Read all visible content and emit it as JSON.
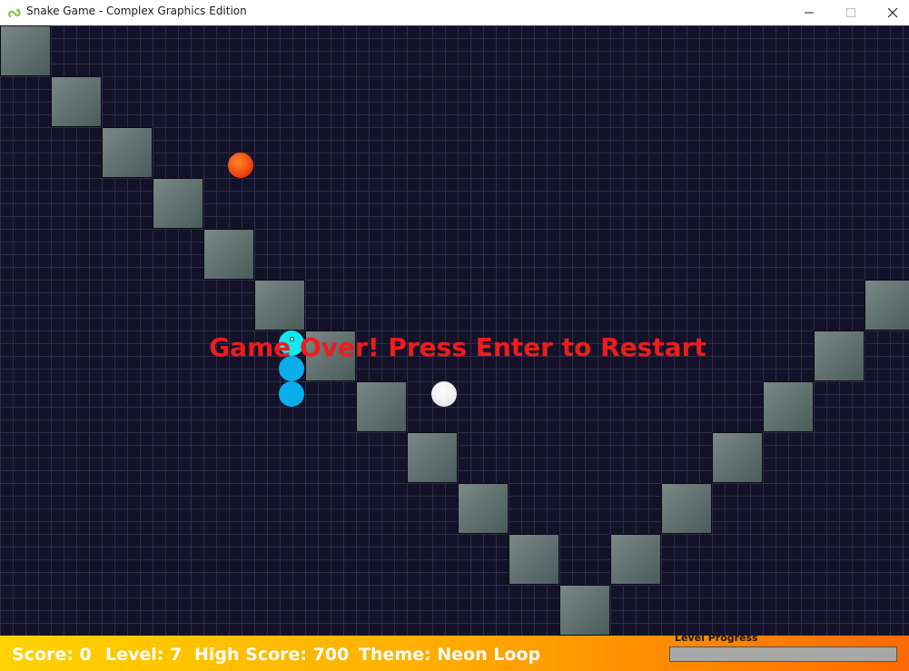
{
  "window": {
    "title": "Snake Game - Complex Graphics Edition",
    "icon": "snake-icon"
  },
  "board": {
    "grid_color": "#2c2d4a",
    "background_color": "#131228",
    "wall_color": "#5f6f6d"
  },
  "game": {
    "game_over_text": "Game Over! Press Enter to Restart",
    "game_over_color": "#ee1c1c",
    "snake_head_color": "#12e8ee",
    "snake_body_color": "#0aaeea",
    "food_colors": [
      "#f04a10",
      "#ececec"
    ]
  },
  "status": {
    "score_text": "Score: 0",
    "level_text": "Level: 7",
    "high_score_text": "High Score: 700",
    "theme_text": "Theme: Neon Loop",
    "progress_label": "Level Progress",
    "progress_fraction": 0
  }
}
